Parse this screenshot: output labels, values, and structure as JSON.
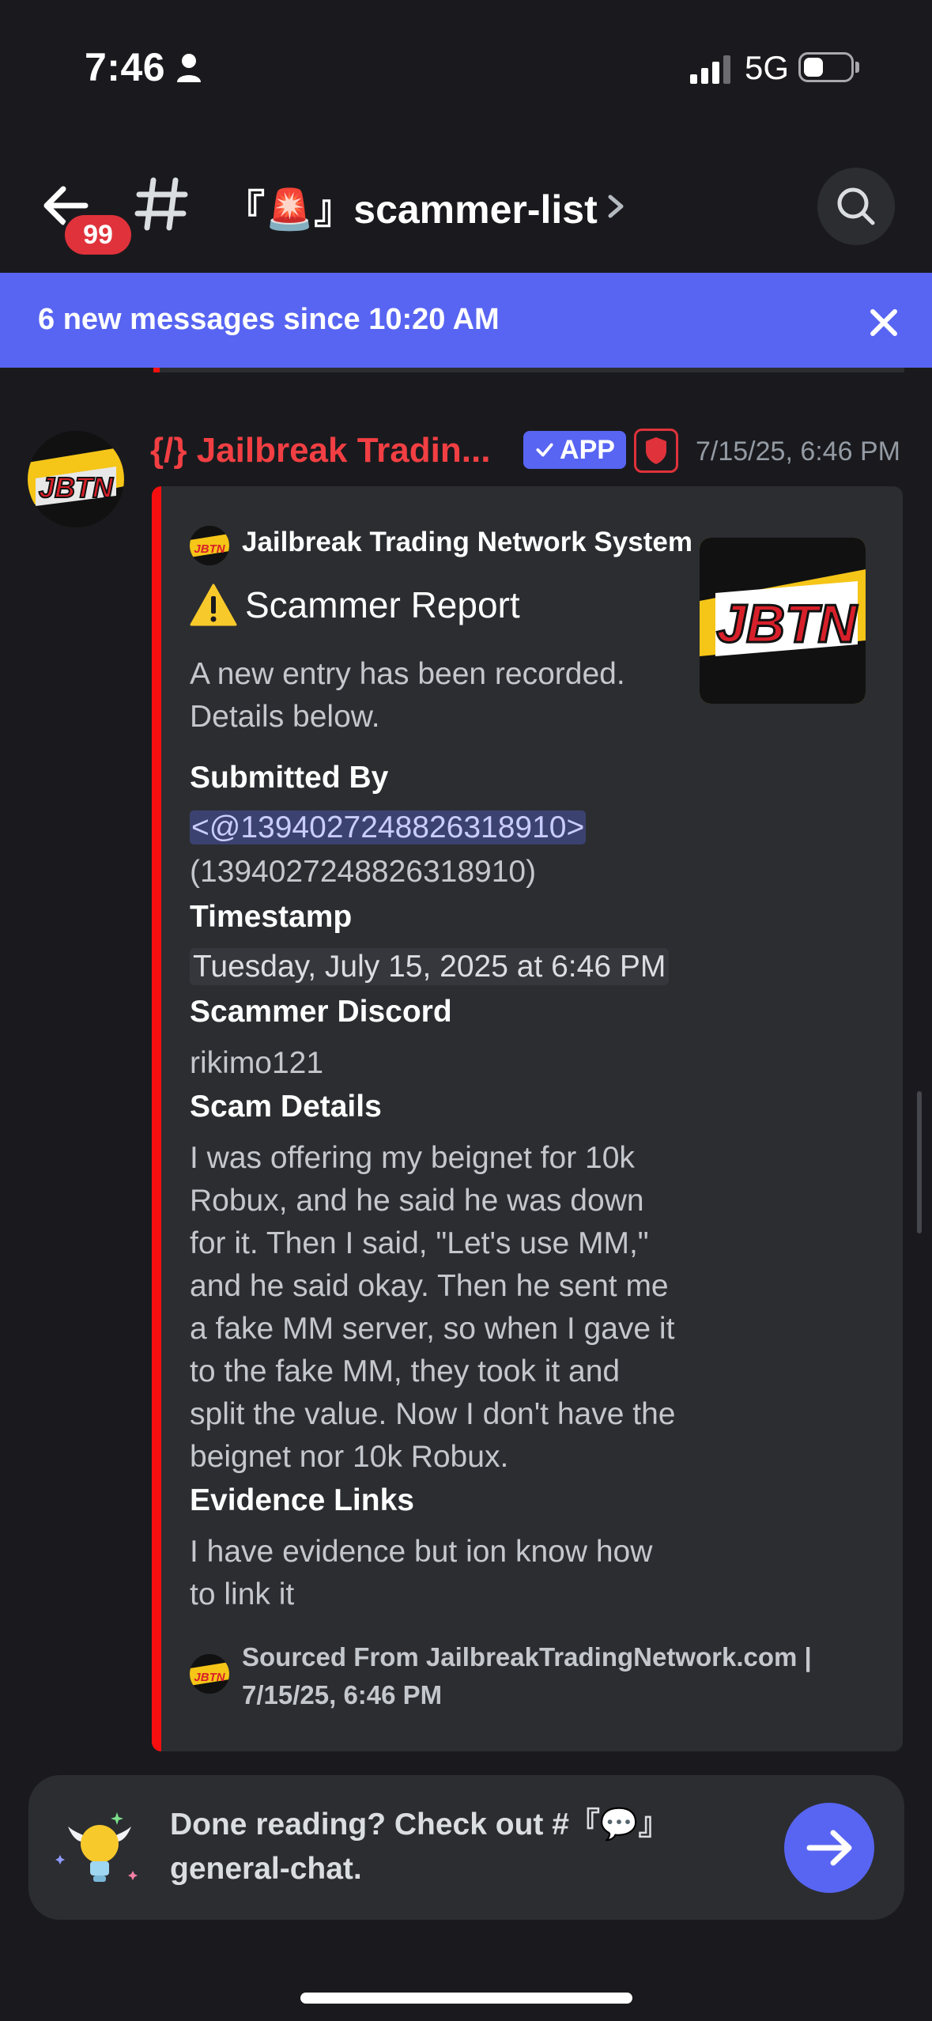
{
  "status_bar": {
    "time": "7:46",
    "network": "5G"
  },
  "header": {
    "unread_badge": "99",
    "channel_name": "『🚨』scammer-list"
  },
  "new_messages_bar": {
    "text": "6 new messages since 10:20 AM"
  },
  "message": {
    "author": "{/} Jailbreak Tradin...",
    "app_tag": "APP",
    "timestamp": "7/15/25, 6:46 PM",
    "embed": {
      "author": "Jailbreak Trading Network System",
      "title": "Scammer Report",
      "description": "A new entry has been recorded. Details below.",
      "thumbnail_text": "JBTN",
      "accent_color": "#f70f0f",
      "fields": {
        "submitted_by": {
          "name": "Submitted By",
          "mention": "<@1394027248826318910>",
          "id": "(1394027248826318910)"
        },
        "timestamp": {
          "name": "Timestamp",
          "value": "Tuesday, July 15, 2025 at 6:46 PM"
        },
        "scammer_discord": {
          "name": "Scammer Discord",
          "value": "rikimo121"
        },
        "scam_details": {
          "name": "Scam Details",
          "value": "I was offering my beignet for 10k Robux, and he said he was down for it. Then I said, \"Let's use MM,\" and he said okay. Then he sent me a fake MM server, so when I gave it to the fake MM, they took it and split the value. Now I don't have the beignet nor 10k Robux."
        },
        "evidence_links": {
          "name": "Evidence Links",
          "value": "I have evidence but ion know how to link it"
        }
      },
      "footer": "Sourced From JailbreakTradingNetwork.com | 7/15/25, 6:46 PM"
    }
  },
  "prompt": {
    "text": "Done reading? Check out #『💬』general-chat."
  },
  "colors": {
    "accent": "#5865f2",
    "danger": "#e0323b",
    "background": "#1a1a1e",
    "embed_bg": "#2b2d31"
  },
  "icons": [
    "person-icon",
    "signal-icon",
    "battery-icon",
    "back-arrow-icon",
    "hash-icon",
    "chevron-right-icon",
    "search-icon",
    "close-icon",
    "checkmark-icon",
    "shield-icon",
    "warning-icon",
    "lightbulb-icon",
    "arrow-right-icon"
  ]
}
